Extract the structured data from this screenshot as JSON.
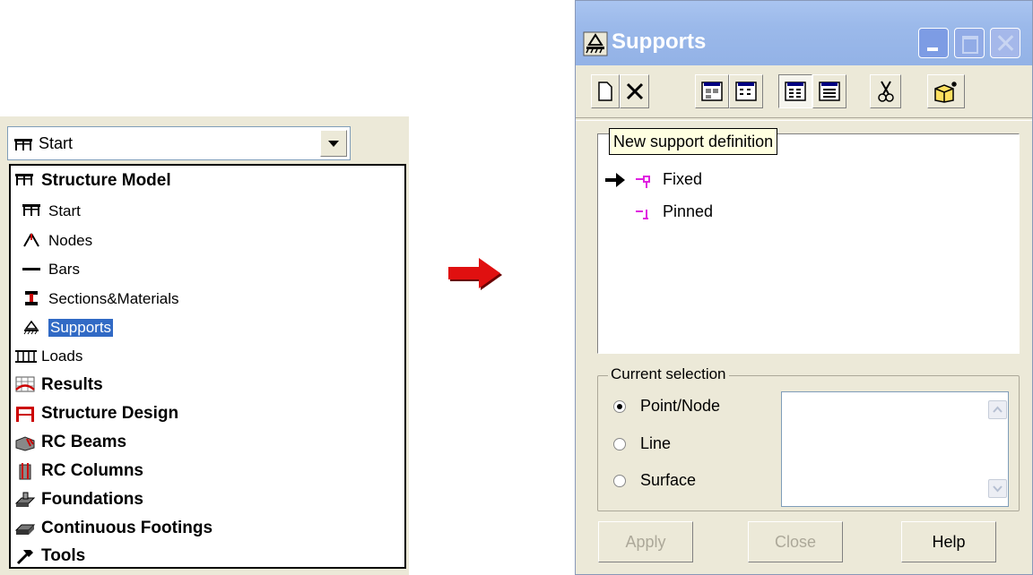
{
  "combo": {
    "value": "Start",
    "icon": "start-icon"
  },
  "dropdown": {
    "items": [
      {
        "label": "Structure Model",
        "icon": "structure-model-icon"
      },
      {
        "label": "Start",
        "icon": "start-icon"
      },
      {
        "label": "Nodes",
        "icon": "nodes-icon"
      },
      {
        "label": "Bars",
        "icon": "bars-icon"
      },
      {
        "label": "Sections&Materials",
        "icon": "sections-materials-icon"
      },
      {
        "label": "Supports",
        "icon": "supports-icon",
        "selected": true
      },
      {
        "label": "Loads",
        "icon": "loads-icon"
      },
      {
        "label": "Results",
        "icon": "results-icon"
      },
      {
        "label": "Structure Design",
        "icon": "structure-design-icon"
      },
      {
        "label": "RC Beams",
        "icon": "rc-beams-icon"
      },
      {
        "label": "RC Columns",
        "icon": "rc-columns-icon"
      },
      {
        "label": "Foundations",
        "icon": "foundations-icon"
      },
      {
        "label": "Continuous Footings",
        "icon": "continuous-footings-icon"
      },
      {
        "label": "Tools",
        "icon": "tools-icon"
      }
    ]
  },
  "arrow": {
    "icon": "red-arrow-icon",
    "color": "#e01010"
  },
  "dialog": {
    "title": "Supports",
    "tooltip": "New support definition",
    "supports": [
      {
        "label": "Fixed",
        "icon": "fixed-support-icon"
      },
      {
        "label": "Pinned",
        "icon": "pinned-support-icon"
      }
    ],
    "current_selection": {
      "legend": "Current selection",
      "options": [
        {
          "label": "Point/Node",
          "checked": true
        },
        {
          "label": "Line",
          "checked": false
        },
        {
          "label": "Surface",
          "checked": false
        }
      ]
    },
    "buttons": {
      "apply": "Apply",
      "close": "Close",
      "help": "Help"
    }
  },
  "colors": {
    "selection": "#316ac5",
    "titlebar": "#9bb9ea",
    "dialog_bg": "#ece9d8",
    "support_icon": "#e020e0"
  }
}
